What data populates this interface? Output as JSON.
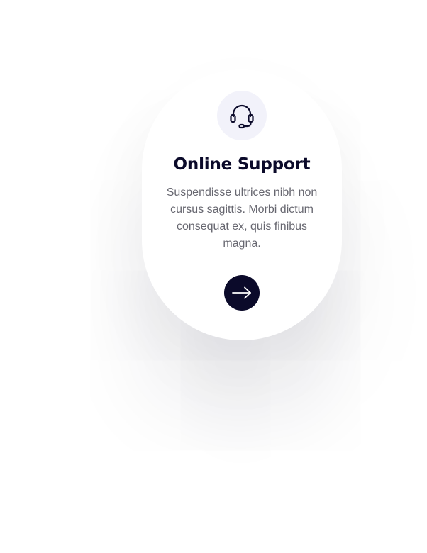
{
  "card": {
    "icon": "headset-icon",
    "title": "Online Support",
    "description": "Suspendisse ultrices nibh non cursus sagittis. Morbi dictum consequat ex, quis finibus magna.",
    "button_icon": "arrow-right-icon"
  },
  "colors": {
    "dark": "#0b0a2a",
    "icon_bg": "#f2f2fa",
    "text_muted": "#676770",
    "card_bg": "#ffffff"
  }
}
